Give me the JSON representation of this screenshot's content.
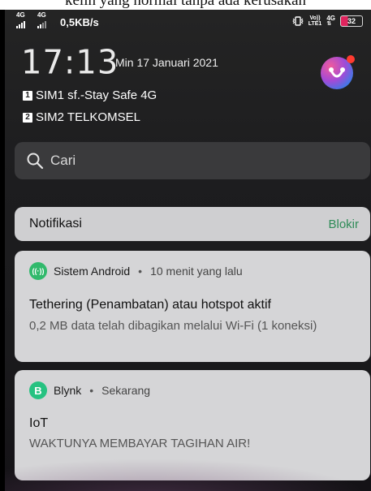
{
  "page_top_text": "kelih yang normal tanpa ada kerusakan",
  "status_bar": {
    "sim1_network": "4G",
    "sim2_network": "4G",
    "speed": "0,5KB/s",
    "volte_top": "Vo))",
    "volte_bottom": "LTE1",
    "right_network": "4G",
    "battery": "32"
  },
  "header": {
    "time": "17:13",
    "date": "Min 17 Januari 2021",
    "sim1_badge": "1",
    "sim1_label": "SIM1 sf.-Stay Safe 4G",
    "sim2_badge": "2",
    "sim2_label": "SIM2 TELKOMSEL"
  },
  "search": {
    "placeholder": "Cari"
  },
  "notifications": {
    "title": "Notifikasi",
    "block_label": "Blokir",
    "items": [
      {
        "app_icon": "hotspot-icon",
        "app_icon_glyph": "((·))",
        "app": "Sistem Android",
        "separator": "•",
        "time": "10 menit yang lalu",
        "title": "Tethering (Penambatan) atau hotspot aktif",
        "body": "0,2 MB data telah dibagikan melalui Wi-Fi (1 koneksi)"
      },
      {
        "app_icon": "blynk-icon",
        "app_icon_glyph": "B",
        "app": "Blynk",
        "separator": "•",
        "time": "Sekarang",
        "title": "IoT",
        "body": "WAKTUNYA MEMBAYAR TAGIHAN AIR!"
      }
    ]
  },
  "colors": {
    "background": "#1d1d1f",
    "card": "#d5d5d7",
    "block_accent": "#2e8b57",
    "app_green": "#31b96c",
    "battery_low": "#e0245e"
  }
}
